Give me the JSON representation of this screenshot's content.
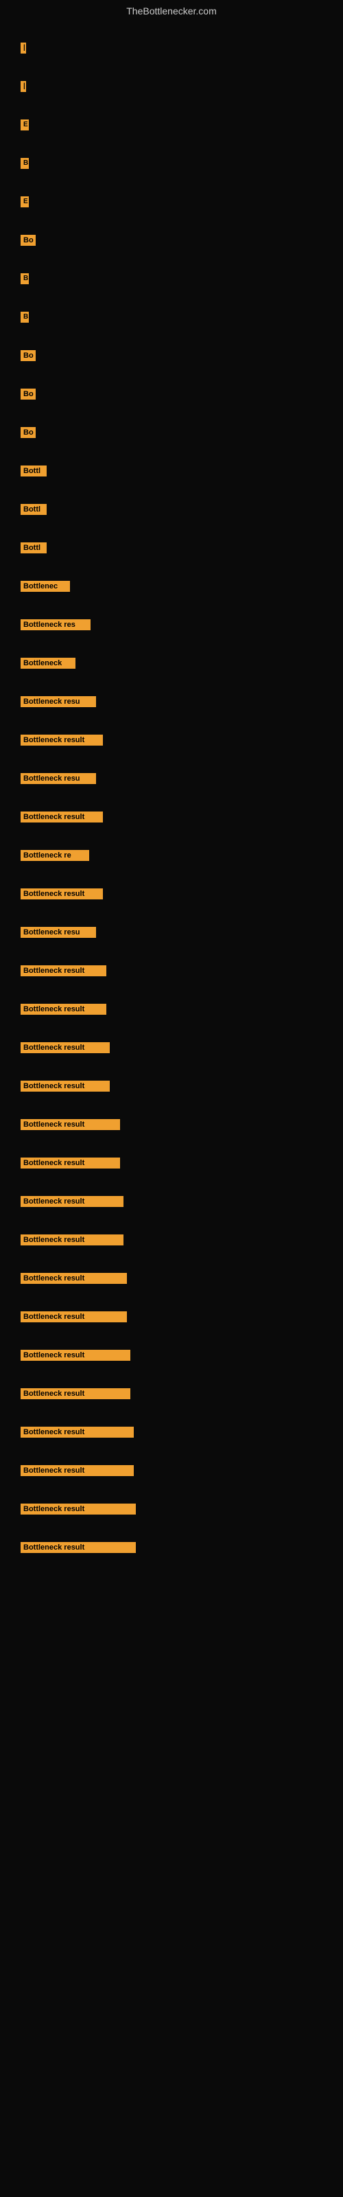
{
  "site": {
    "title": "TheBottlenecker.com"
  },
  "bars": [
    {
      "label": "|",
      "width": 8
    },
    {
      "label": "|",
      "width": 8
    },
    {
      "label": "E",
      "width": 12
    },
    {
      "label": "B",
      "width": 12
    },
    {
      "label": "E",
      "width": 12
    },
    {
      "label": "Bo",
      "width": 22
    },
    {
      "label": "B",
      "width": 12
    },
    {
      "label": "B",
      "width": 12
    },
    {
      "label": "Bo",
      "width": 22
    },
    {
      "label": "Bo",
      "width": 22
    },
    {
      "label": "Bo",
      "width": 22
    },
    {
      "label": "Bottl",
      "width": 38
    },
    {
      "label": "Bottl",
      "width": 38
    },
    {
      "label": "Bottl",
      "width": 38
    },
    {
      "label": "Bottlenec",
      "width": 72
    },
    {
      "label": "Bottleneck res",
      "width": 102
    },
    {
      "label": "Bottleneck",
      "width": 80
    },
    {
      "label": "Bottleneck resu",
      "width": 110
    },
    {
      "label": "Bottleneck result",
      "width": 120
    },
    {
      "label": "Bottleneck resu",
      "width": 110
    },
    {
      "label": "Bottleneck result",
      "width": 120
    },
    {
      "label": "Bottleneck re",
      "width": 100
    },
    {
      "label": "Bottleneck result",
      "width": 120
    },
    {
      "label": "Bottleneck resu",
      "width": 110
    },
    {
      "label": "Bottleneck result",
      "width": 125
    },
    {
      "label": "Bottleneck result",
      "width": 125
    },
    {
      "label": "Bottleneck result",
      "width": 130
    },
    {
      "label": "Bottleneck result",
      "width": 130
    },
    {
      "label": "Bottleneck result",
      "width": 145
    },
    {
      "label": "Bottleneck result",
      "width": 145
    },
    {
      "label": "Bottleneck result",
      "width": 150
    },
    {
      "label": "Bottleneck result",
      "width": 150
    },
    {
      "label": "Bottleneck result",
      "width": 155
    },
    {
      "label": "Bottleneck result",
      "width": 155
    },
    {
      "label": "Bottleneck result",
      "width": 160
    },
    {
      "label": "Bottleneck result",
      "width": 160
    },
    {
      "label": "Bottleneck result",
      "width": 165
    },
    {
      "label": "Bottleneck result",
      "width": 165
    },
    {
      "label": "Bottleneck result",
      "width": 168
    },
    {
      "label": "Bottleneck result",
      "width": 168
    }
  ]
}
